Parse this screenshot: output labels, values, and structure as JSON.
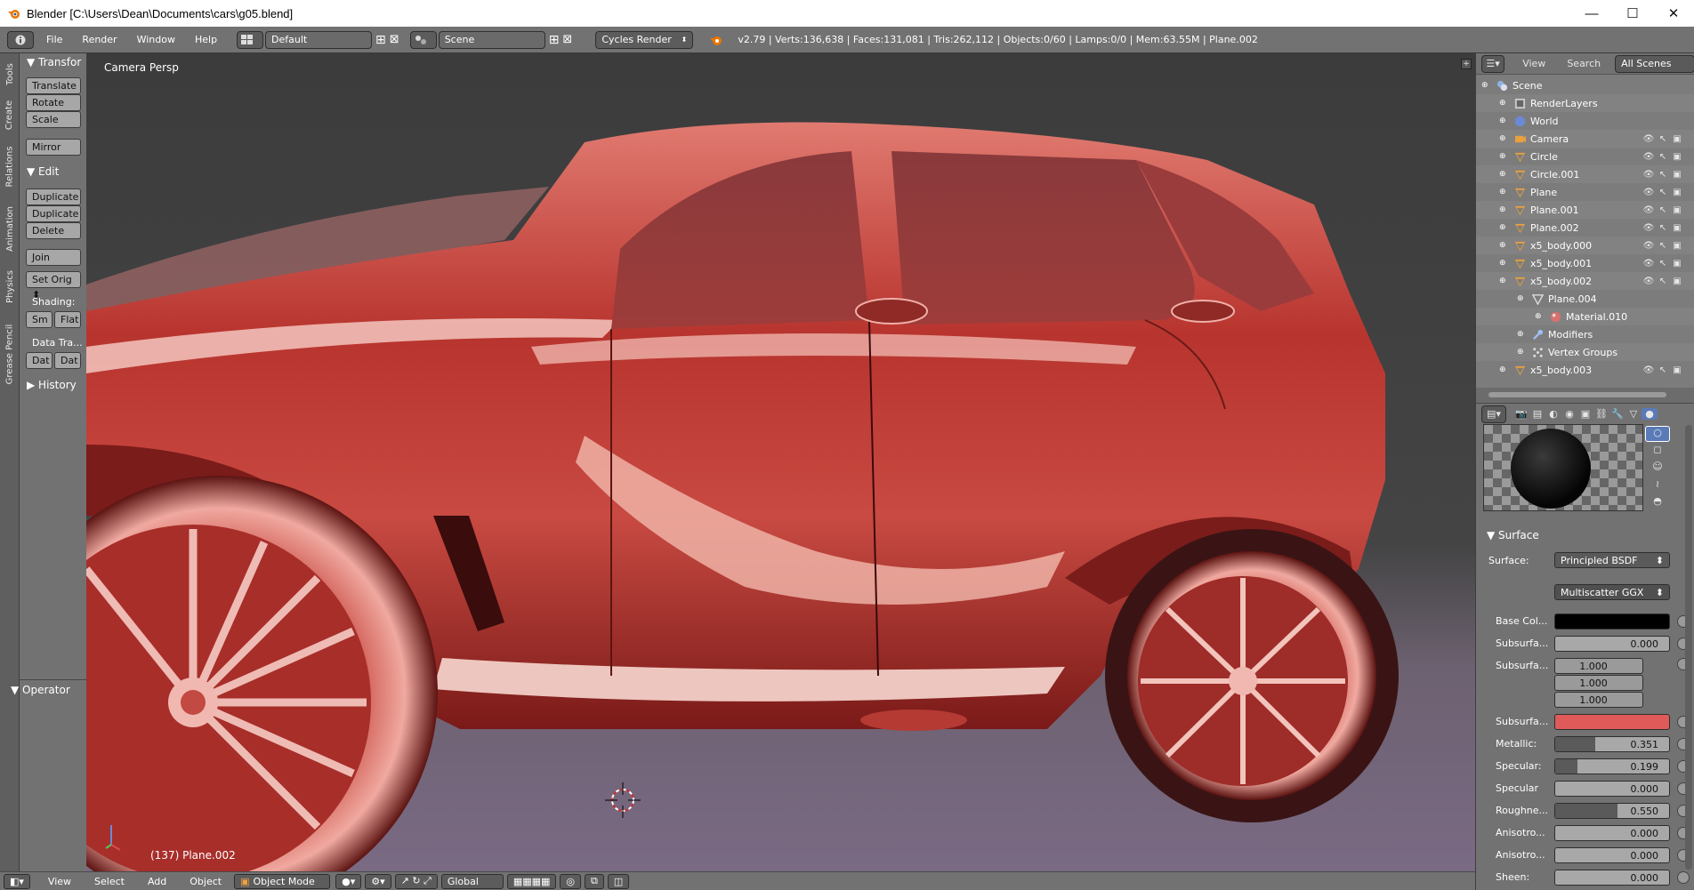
{
  "window": {
    "title": "Blender [C:\\Users\\Dean\\Documents\\cars\\g05.blend]",
    "minimize": "—",
    "maximize": "☐",
    "close": "✕"
  },
  "info_bar": {
    "menus": [
      "File",
      "Render",
      "Window",
      "Help"
    ],
    "screen_layout": "Default",
    "scene": "Scene",
    "render_engine": "Cycles Render",
    "stats": "v2.79 | Verts:136,638 | Faces:131,081 | Tris:262,112 | Objects:0/60 | Lamps:0/0 | Mem:63.55M | Plane.002"
  },
  "tool_tabs": [
    "Tools",
    "Create",
    "Relations",
    "Animation",
    "Physics",
    "Grease Pencil"
  ],
  "tool_shelf": {
    "transform_header": "Transfor",
    "transform_buttons": [
      "Translate",
      "Rotate",
      "Scale"
    ],
    "mirror": "Mirror",
    "edit_header": "Edit",
    "edit_buttons": [
      "Duplicate",
      "Duplicate",
      "Delete"
    ],
    "join": "Join",
    "set_origin": "Set Orig",
    "shading_label": "Shading:",
    "smooth": "Sm",
    "flat": "Flat",
    "data_transfer_label": "Data Tra...",
    "dat1": "Dat",
    "dat2": "Dat",
    "history_header": "History",
    "operator_header": "Operator"
  },
  "viewport": {
    "view_label": "Camera Persp",
    "object_label": "(137) Plane.002",
    "car_color": "#c0403a"
  },
  "bottom_bar": {
    "menus": [
      "View",
      "Select",
      "Add",
      "Object"
    ],
    "mode": "Object Mode",
    "orientation": "Global"
  },
  "outliner": {
    "header_items": [
      "View",
      "Search",
      "All Scenes"
    ],
    "rows": [
      {
        "name": "Scene",
        "indent": 0,
        "icon": "scene"
      },
      {
        "name": "RenderLayers",
        "indent": 1,
        "icon": "renderlayers"
      },
      {
        "name": "World",
        "indent": 1,
        "icon": "world"
      },
      {
        "name": "Camera",
        "indent": 1,
        "icon": "camera"
      },
      {
        "name": "Circle",
        "indent": 1,
        "icon": "mesh"
      },
      {
        "name": "Circle.001",
        "indent": 1,
        "icon": "mesh"
      },
      {
        "name": "Plane",
        "indent": 1,
        "icon": "mesh"
      },
      {
        "name": "Plane.001",
        "indent": 1,
        "icon": "mesh"
      },
      {
        "name": "Plane.002",
        "indent": 1,
        "icon": "mesh"
      },
      {
        "name": "x5_body.000",
        "indent": 1,
        "icon": "mesh"
      },
      {
        "name": "x5_body.001",
        "indent": 1,
        "icon": "mesh"
      },
      {
        "name": "x5_body.002",
        "indent": 1,
        "icon": "mesh"
      },
      {
        "name": "Plane.004",
        "indent": 2,
        "icon": "meshdata"
      },
      {
        "name": "Material.010",
        "indent": 3,
        "icon": "material"
      },
      {
        "name": "Modifiers",
        "indent": 2,
        "icon": "wrench"
      },
      {
        "name": "Vertex Groups",
        "indent": 2,
        "icon": "vgroup"
      },
      {
        "name": "x5_body.003",
        "indent": 1,
        "icon": "mesh"
      }
    ]
  },
  "properties": {
    "surface_header": "Surface",
    "surface_label": "Surface:",
    "surface_value": "Principled BSDF",
    "distribution_value": "Multiscatter GGX",
    "rows": [
      {
        "label": "Base Col...",
        "type": "color",
        "color": "#000000"
      },
      {
        "label": "Subsurfa...",
        "type": "value",
        "value": "0.000",
        "fill": 0
      },
      {
        "label": "Subsurfa...",
        "type": "vector",
        "values": [
          "1.000",
          "1.000",
          "1.000"
        ]
      },
      {
        "label": "Subsurfa...",
        "type": "color",
        "color": "#e05a5a"
      },
      {
        "label": "Metallic:",
        "type": "value",
        "value": "0.351",
        "fill": 0.351
      },
      {
        "label": "Specular:",
        "type": "value",
        "value": "0.199",
        "fill": 0.199
      },
      {
        "label": "Specular",
        "type": "value",
        "value": "0.000",
        "fill": 0
      },
      {
        "label": "Roughne...",
        "type": "value",
        "value": "0.550",
        "fill": 0.55
      },
      {
        "label": "Anisotro...",
        "type": "value",
        "value": "0.000",
        "fill": 0
      },
      {
        "label": "Anisotro...",
        "type": "value",
        "value": "0.000",
        "fill": 0
      },
      {
        "label": "Sheen:",
        "type": "value",
        "value": "0.000",
        "fill": 0
      }
    ]
  }
}
